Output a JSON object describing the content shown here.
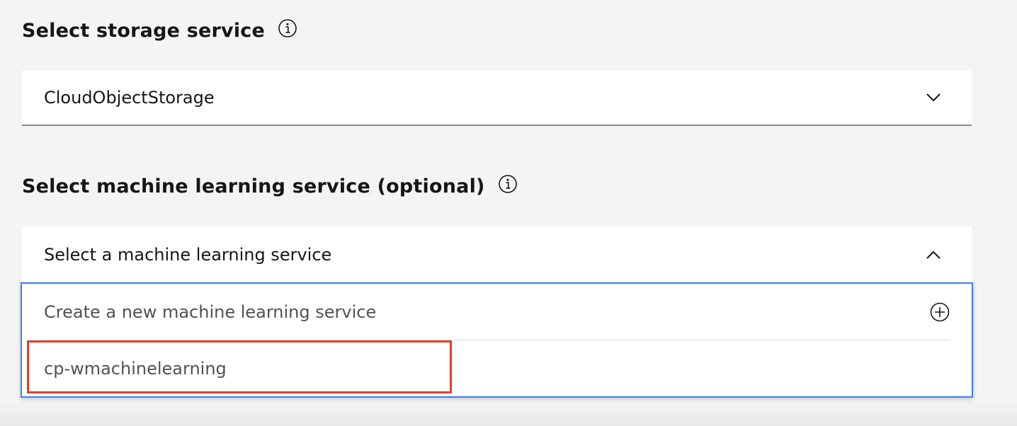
{
  "storage": {
    "title": "Select storage service",
    "selected_value": "CloudObjectStorage",
    "info_icon": "info-icon",
    "chevron_icon": "chevron-down-icon"
  },
  "ml": {
    "title": "Select machine learning service (optional)",
    "placeholder": "Select a machine learning service",
    "info_icon": "info-icon",
    "chevron_icon": "chevron-up-icon",
    "options": [
      {
        "label": "Create a new machine learning service",
        "icon": "add-circle-icon"
      },
      {
        "label": "cp-wmachinelearning"
      }
    ]
  },
  "colors": {
    "focus_border": "#3d7cf0",
    "highlight_border": "#e0402a",
    "background": "#f4f4f4"
  }
}
